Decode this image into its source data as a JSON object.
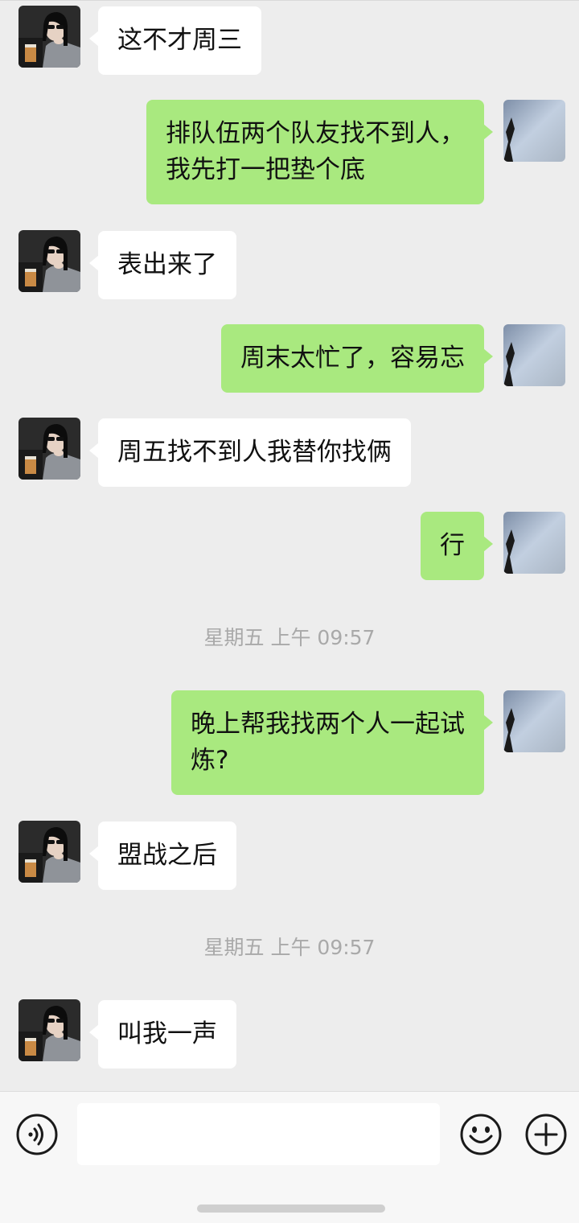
{
  "conversation": {
    "messages": [
      {
        "side": "left",
        "text": "这不才周三"
      },
      {
        "side": "right",
        "text": "排队伍两个队友找不到人，\n我先打一把垫个底"
      },
      {
        "side": "left",
        "text": "表出来了"
      },
      {
        "side": "right",
        "text": "周末太忙了，容易忘"
      },
      {
        "side": "left",
        "text": "周五找不到人我替你找俩"
      },
      {
        "side": "right",
        "text": "行"
      },
      {
        "type": "time",
        "text": "星期五 上午 09:57"
      },
      {
        "side": "right",
        "text": "晚上帮我找两个人一起试\n炼?"
      },
      {
        "side": "left",
        "text": "盟战之后"
      },
      {
        "type": "time",
        "text": "星期五 上午 09:57"
      },
      {
        "side": "left",
        "text": "叫我一声"
      }
    ]
  },
  "input_bar": {
    "voice_icon": "voice-icon",
    "emoji_icon": "emoji-icon",
    "plus_icon": "plus-icon",
    "text_value": ""
  },
  "colors": {
    "background": "#ededed",
    "sent_bubble": "#a9e97f",
    "received_bubble": "#ffffff",
    "timestamp": "#a9a9a9"
  }
}
